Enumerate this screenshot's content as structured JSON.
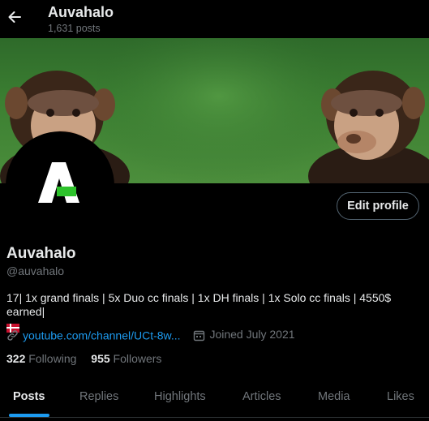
{
  "header": {
    "title": "Auvahalo",
    "posts": "1,631 posts"
  },
  "profile": {
    "display_name": "Auvahalo",
    "handle": "@auvahalo",
    "bio": "17| 1x grand finals | 5x Duo cc finals | 1x DH finals | 1x Solo cc finals | 4550$ earned|",
    "link": "youtube.com/channel/UCt-8w...",
    "joined": "Joined July 2021",
    "following_count": "322",
    "following_label": "Following",
    "followers_count": "955",
    "followers_label": "Followers",
    "edit_label": "Edit profile"
  },
  "tabs": [
    {
      "label": "Posts",
      "active": true
    },
    {
      "label": "Replies"
    },
    {
      "label": "Highlights"
    },
    {
      "label": "Articles"
    },
    {
      "label": "Media"
    },
    {
      "label": "Likes"
    }
  ],
  "icons": {
    "back": "arrow-left-icon",
    "link": "link-icon",
    "calendar": "calendar-icon",
    "flag": "denmark-flag-icon"
  },
  "colors": {
    "accent": "#1d9bf0",
    "text": "#e7e9ea",
    "muted": "#71767b",
    "logo_green": "#2dc22b"
  }
}
